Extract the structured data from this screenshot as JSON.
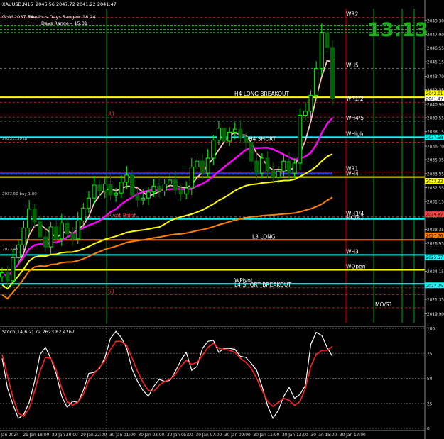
{
  "header": {
    "symbol_line": "XAUUSD,M15",
    "ohlc": "2046.56 2047.72 2041.22 2041.47",
    "prev_days_range_label": "Previous Days Range= 18.24",
    "days_range_label": "Days Range= 15.31",
    "gold_label": "Gold 2037.54",
    "clock": "13:13"
  },
  "chart_data": [
    {
      "type": "candlestick",
      "title": "XAUUSD,M15",
      "ylim": [
        2019.0,
        2050.5
      ],
      "price_axis_ticks": [
        "2049.30",
        "2047.90",
        "2046.55",
        "2045.15",
        "2043.70",
        "2042.35",
        "2040.90",
        "2039.55",
        "2038.15",
        "2036.70",
        "2035.35",
        "2033.95",
        "2032.55",
        "2031.15",
        "2029.75",
        "2028.35",
        "2026.95",
        "2025.55",
        "2024.15",
        "2022.70",
        "2021.35",
        "2019.90"
      ],
      "price_tags": [
        {
          "value": 2042.01,
          "label": "2042.01",
          "color": "#ffff00"
        },
        {
          "value": 2041.47,
          "label": "2041.47",
          "color": "#ffffff"
        },
        {
          "value": 2037.58,
          "label": "2037.58",
          "color": "#00ffff"
        },
        {
          "value": 2033.22,
          "label": "2033.22",
          "color": "#ffff00"
        },
        {
          "value": 2029.87,
          "label": "2029.87",
          "color": "#ff4040"
        },
        {
          "value": 2027.76,
          "label": "2027.76",
          "color": "#ff8000"
        },
        {
          "value": 2025.57,
          "label": "2025.57",
          "color": "#00ffff"
        },
        {
          "value": 2022.75,
          "label": "2022.75",
          "color": "#00ffff"
        }
      ],
      "time_labels": [
        "29 Jan 2024",
        "29 Jan 18:00",
        "29 Jan 20:00",
        "29 Jan 22:00",
        "30 Jan 01:00",
        "30 Jan 03:00",
        "30 Jan 05:00",
        "30 Jan 07:00",
        "30 Jan 09:00",
        "30 Jan 11:00",
        "30 Jan 13:00",
        "30 Jan 15:00",
        "30 Jan 17:00"
      ],
      "close_series": [
        2024.0,
        2023.2,
        2025.5,
        2026.8,
        2028.5,
        2030.4,
        2029.1,
        2027.6,
        2026.6,
        2028.6,
        2027.4,
        2029.0,
        2027.9,
        2027.4,
        2029.2,
        2030.5,
        2031.5,
        2032.8,
        2032.2,
        2032.9,
        2031.8,
        2032.0,
        2033.1,
        2033.8,
        2031.8,
        2031.3,
        2031.5,
        2032.1,
        2032.7,
        2032.2,
        2032.9,
        2033.3,
        2032.3,
        2031.9,
        2032.5,
        2034.6,
        2035.2,
        2034.0,
        2035.5,
        2037.3,
        2038.5,
        2037.2,
        2038.1,
        2038.4,
        2037.6,
        2037.1,
        2035.2,
        2034.0,
        2035.5,
        2034.2,
        2033.6,
        2034.2,
        2035.2,
        2034.0,
        2035.0,
        2039.8,
        2040.2,
        2041.8,
        2044.5,
        2048.1,
        2046.6,
        2041.5
      ],
      "support_resistance_labels": [
        {
          "label": "WR2",
          "value": 2049.6
        },
        {
          "label": "WH5",
          "value": 2044.5
        },
        {
          "label": "H4 LONG BREAKOUT",
          "value": 2041.6
        },
        {
          "label": "WR1/2",
          "value": 2041.1
        },
        {
          "label": "R1",
          "value": 2039.6
        },
        {
          "label": "WH4/5",
          "value": 2039.2
        },
        {
          "label": "WHigh",
          "value": 2037.6
        },
        {
          "label": "H4 SHORT",
          "value": 2037.1
        },
        {
          "label": "WR1",
          "value": 2034.1
        },
        {
          "label": "WH4",
          "value": 2033.6
        },
        {
          "label": "WH3/4",
          "value": 2029.6
        },
        {
          "label": "MO/R1",
          "value": 2029.2
        },
        {
          "label": "Pivot Point",
          "value": 2029.4
        },
        {
          "label": "L3 LONG",
          "value": 2027.3
        },
        {
          "label": "WH3",
          "value": 2025.8
        },
        {
          "label": "WOpen",
          "value": 2024.3
        },
        {
          "label": "WPivot",
          "value": 2022.9
        },
        {
          "label": "L4 SHORT BREAKOUT",
          "value": 2022.5
        },
        {
          "label": "S1",
          "value": 2021.8
        },
        {
          "label": "MO/S1",
          "value": 2020.5
        }
      ],
      "left_labels": [
        "20231130 tp",
        "2037.50 buy 1.00",
        "2023.45 11 ..."
      ],
      "colors": {
        "up_candle": "#00ff00",
        "down_candle": "#006400",
        "ma_fast": "#ffc0c0",
        "ma_mid": "#ff00ff",
        "ma_slow": "#ffff00",
        "ma_slowest": "#ff8000"
      }
    },
    {
      "type": "line",
      "title": "Stoch(14,6,2) 72.2623 82.4267",
      "ylim": [
        0,
        100
      ],
      "y_ticks": [
        "100",
        "75",
        "50",
        "25",
        "0"
      ],
      "series": [
        {
          "name": "main",
          "color": "#ffffff",
          "values": [
            70,
            40,
            24,
            10,
            14,
            26,
            47,
            74,
            81,
            70,
            54,
            32,
            21,
            27,
            26,
            38,
            55,
            56,
            60,
            71,
            90,
            97,
            91,
            80,
            59,
            47,
            38,
            32,
            42,
            49,
            47,
            48,
            57,
            68,
            76,
            58,
            62,
            80,
            87,
            88,
            76,
            80,
            80,
            79,
            72,
            71,
            65,
            58,
            42,
            23,
            10,
            18,
            32,
            41,
            30,
            34,
            43,
            84,
            96,
            93,
            81,
            72
          ]
        },
        {
          "name": "signal",
          "color": "#ff2020",
          "values": [
            74,
            52,
            31,
            15,
            12,
            20,
            37,
            57,
            71,
            70,
            58,
            40,
            27,
            23,
            26,
            34,
            48,
            55,
            61,
            68,
            79,
            87,
            87,
            83,
            70,
            57,
            46,
            38,
            37,
            43,
            47,
            49,
            54,
            62,
            68,
            64,
            66,
            73,
            81,
            85,
            80,
            79,
            78,
            76,
            70,
            66,
            60,
            50,
            38,
            27,
            22,
            26,
            30,
            28,
            23,
            27,
            40,
            62,
            74,
            78,
            78,
            82
          ]
        }
      ]
    }
  ]
}
